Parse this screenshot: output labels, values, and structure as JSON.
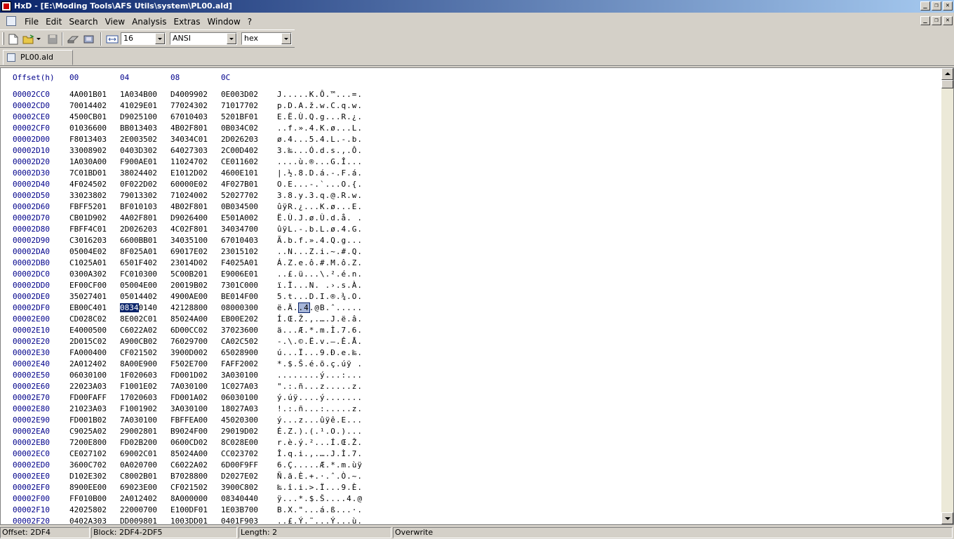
{
  "window": {
    "title": "HxD - [E:\\Moding Tools\\AFS Utils\\system\\PL00.ald]",
    "buttons": [
      "_",
      "❐",
      "✕"
    ]
  },
  "menu": {
    "items": [
      "File",
      "Edit",
      "Search",
      "View",
      "Analysis",
      "Extras",
      "Window",
      "?"
    ]
  },
  "toolbar": {
    "bytes_per_row": "16",
    "charset": "ANSI",
    "display_mode": "hex"
  },
  "tabs": [
    {
      "label": "PL00.ald"
    }
  ],
  "editor": {
    "header": {
      "offset": "Offset(h)",
      "col0": "00",
      "col4": "04",
      "col8": "08",
      "colC": "0C"
    },
    "rows": [
      {
        "off": "00002CC0",
        "b0": "4A001B01",
        "b4": "1A034B00",
        "b8": "D4009902",
        "bc": "0E003D02",
        "txt": "J.....K.Ô.™...=."
      },
      {
        "off": "00002CD0",
        "b0": "70014402",
        "b4": "41029E01",
        "b8": "77024302",
        "bc": "71017702",
        "txt": "p.D.A.ž.w.C.q.w."
      },
      {
        "off": "00002CE0",
        "b0": "4500CB01",
        "b4": "D9025100",
        "b8": "67010403",
        "bc": "5201BF01",
        "txt": "E.Ë.Ù.Q.g...R.¿."
      },
      {
        "off": "00002CF0",
        "b0": "01036600",
        "b4": "BB013403",
        "b8": "4B02F801",
        "bc": "0B034C02",
        "txt": "..f.».4.K.ø...L."
      },
      {
        "off": "00002D00",
        "b0": "F8013403",
        "b4": "2E003502",
        "b8": "34034C01",
        "bc": "2D026203",
        "txt": "ø.4...5.4.L.-.b."
      },
      {
        "off": "00002D10",
        "b0": "33008902",
        "b4": "0403D302",
        "b8": "64027303",
        "bc": "2C00D402",
        "txt": "3.‰...Ó.d.s.,.Ô."
      },
      {
        "off": "00002D20",
        "b0": "1A030A00",
        "b4": "F900AE01",
        "b8": "11024702",
        "bc": "CE011602",
        "txt": "....ù.®...G.Î..."
      },
      {
        "off": "00002D30",
        "b0": "7C01BD01",
        "b4": "38024402",
        "b8": "E1012D02",
        "bc": "4600E101",
        "txt": "|.½.8.D.á.-.F.á."
      },
      {
        "off": "00002D40",
        "b0": "4F024502",
        "b4": "0F022D02",
        "b8": "60000E02",
        "bc": "4F027B01",
        "txt": "O.E...-.`...O.{."
      },
      {
        "off": "00002D50",
        "b0": "33023802",
        "b4": "79013302",
        "b8": "71024002",
        "bc": "52027702",
        "txt": "3.8.y.3.q.@.R.w."
      },
      {
        "off": "00002D60",
        "b0": "FBFF5201",
        "b4": "BF010103",
        "b8": "4B02F801",
        "bc": "0B034500",
        "txt": "ûÿR.¿...K.ø...E."
      },
      {
        "off": "00002D70",
        "b0": "CB01D902",
        "b4": "4A02F801",
        "b8": "D9026400",
        "bc": "E501A002",
        "txt": "Ë.Ù.J.ø.Ù.d.å. ."
      },
      {
        "off": "00002D80",
        "b0": "FBFF4C01",
        "b4": "2D026203",
        "b8": "4C02F801",
        "bc": "34034700",
        "txt": "ûÿL.-.b.L.ø.4.G."
      },
      {
        "off": "00002D90",
        "b0": "C3016203",
        "b4": "6600BB01",
        "b8": "34035100",
        "bc": "67010403",
        "txt": "Ã.b.f.».4.Q.g..."
      },
      {
        "off": "00002DA0",
        "b0": "05004E02",
        "b4": "8F025A01",
        "b8": "69017E02",
        "bc": "23015102",
        "txt": "..N...Z.i.~.#.Q."
      },
      {
        "off": "00002DB0",
        "b0": "C1025A01",
        "b4": "6501F402",
        "b8": "23014D02",
        "bc": "F4025A01",
        "txt": "Á.Z.e.ô.#.M.ô.Z."
      },
      {
        "off": "00002DC0",
        "b0": "0300A302",
        "b4": "FC010300",
        "b8": "5C00B201",
        "bc": "E9006E01",
        "txt": "..£.ü...\\.².é.n."
      },
      {
        "off": "00002DD0",
        "b0": "EF00CF00",
        "b4": "05004E00",
        "b8": "20019B02",
        "bc": "7301C000",
        "txt": "ï.Ï...N. .›.s.À."
      },
      {
        "off": "00002DE0",
        "b0": "35027401",
        "b4": "05014402",
        "b8": "4900AE00",
        "bc": "BE014F00",
        "txt": "5.t...D.I.®.¾.O."
      },
      {
        "off": "00002DF0",
        "b0": "EB00C401",
        "b4": "08340140",
        "b8": "42128800",
        "bc": "08000300",
        "txt": "ë.Ä..4.@B.ˆ....."
      },
      {
        "off": "00002E00",
        "b0": "CD028C02",
        "b4": "8E002C01",
        "b8": "85024A00",
        "bc": "EB00E202",
        "txt": "Í.Œ.Ž.,.….J.ë.â."
      },
      {
        "off": "00002E10",
        "b0": "E4000500",
        "b4": "C6022A02",
        "b8": "6D00CC02",
        "bc": "37023600",
        "txt": "ä...Æ.*.m.Ì.7.6."
      },
      {
        "off": "00002E20",
        "b0": "2D015C02",
        "b4": "A900CB02",
        "b8": "76029700",
        "bc": "CA02C502",
        "txt": "-.\\.©.Ë.v.—.Ê.Å."
      },
      {
        "off": "00002E30",
        "b0": "FA000400",
        "b4": "CF021502",
        "b8": "3900D002",
        "bc": "65028900",
        "txt": "ú...Ï...9.Ð.e.‰."
      },
      {
        "off": "00002E40",
        "b0": "2A012402",
        "b4": "8A00E900",
        "b8": "F502E700",
        "bc": "FAFF2002",
        "txt": "*.$.Š.é.õ.ç.úÿ ."
      },
      {
        "off": "00002E50",
        "b0": "06030100",
        "b4": "1F020603",
        "b8": "FD001D02",
        "bc": "3A030100",
        "txt": "........ý...:..."
      },
      {
        "off": "00002E60",
        "b0": "22023A03",
        "b4": "F1001E02",
        "b8": "7A030100",
        "bc": "1C027A03",
        "txt": "\".:.ñ...z.....z."
      },
      {
        "off": "00002E70",
        "b0": "FD00FAFF",
        "b4": "17020603",
        "b8": "FD001A02",
        "bc": "06030100",
        "txt": "ý.úÿ....ý......."
      },
      {
        "off": "00002E80",
        "b0": "21023A03",
        "b4": "F1001902",
        "b8": "3A030100",
        "bc": "18027A03",
        "txt": "!.:.ñ...:.....z."
      },
      {
        "off": "00002E90",
        "b0": "FD001B02",
        "b4": "7A030100",
        "b8": "FBFFEA00",
        "bc": "45020300",
        "txt": "ý...z...ûÿê.E..."
      },
      {
        "off": "00002EA0",
        "b0": "C9025A02",
        "b4": "29002801",
        "b8": "B9024F00",
        "bc": "29019D02",
        "txt": "É.Z.).(.¹.O.)..."
      },
      {
        "off": "00002EB0",
        "b0": "7200E800",
        "b4": "FD02B200",
        "b8": "0600CD02",
        "bc": "8C028E00",
        "txt": "r.è.ý.²...Í.Œ.Ž."
      },
      {
        "off": "00002EC0",
        "b0": "CE027102",
        "b4": "69002C01",
        "b8": "85024A00",
        "bc": "CC023702",
        "txt": "Î.q.i.,.….J.Ì.7."
      },
      {
        "off": "00002ED0",
        "b0": "3600C702",
        "b4": "0A020700",
        "b8": "C6022A02",
        "bc": "6D00F9FF",
        "txt": "6.Ç.....Æ.*.m.ùÿ"
      },
      {
        "off": "00002EE0",
        "b0": "D102E302",
        "b4": "C8002B01",
        "b8": "B7028800",
        "bc": "D2027E02",
        "txt": "Ñ.ã.È.+.·.ˆ.Ò.~."
      },
      {
        "off": "00002EF0",
        "b0": "8900EE00",
        "b4": "69023E00",
        "b8": "CF021502",
        "bc": "3900C802",
        "txt": "‰.î.i.>.Ï...9.È."
      },
      {
        "off": "00002F00",
        "b0": "FF010B00",
        "b4": "2A012402",
        "b8": "8A000000",
        "bc": "08340440",
        "txt": "ÿ...*.$.Š....4.@"
      },
      {
        "off": "00002F10",
        "b0": "42025802",
        "b4": "22000700",
        "b8": "E100DF01",
        "bc": "1E03B700",
        "txt": "B.X.\"...á.ß...·."
      },
      {
        "off": "00002F20",
        "b0": "0402A303",
        "b4": "DD009801",
        "b8": "1003DD01",
        "bc": "0401F903",
        "txt": "..£.Ý.˜...Ý...ù."
      }
    ],
    "selection": {
      "row_offset": "00002DF0",
      "hex_selected": "0834",
      "hex_rest": "0140",
      "text_pre": "ë.Ä.",
      "text_selected": ".4",
      "text_post": ".@B.ˆ....."
    }
  },
  "status": {
    "offset": "Offset: 2DF4",
    "block": "Block: 2DF4-2DF5",
    "length": "Length: 2",
    "empty": "",
    "mode": "Overwrite"
  }
}
